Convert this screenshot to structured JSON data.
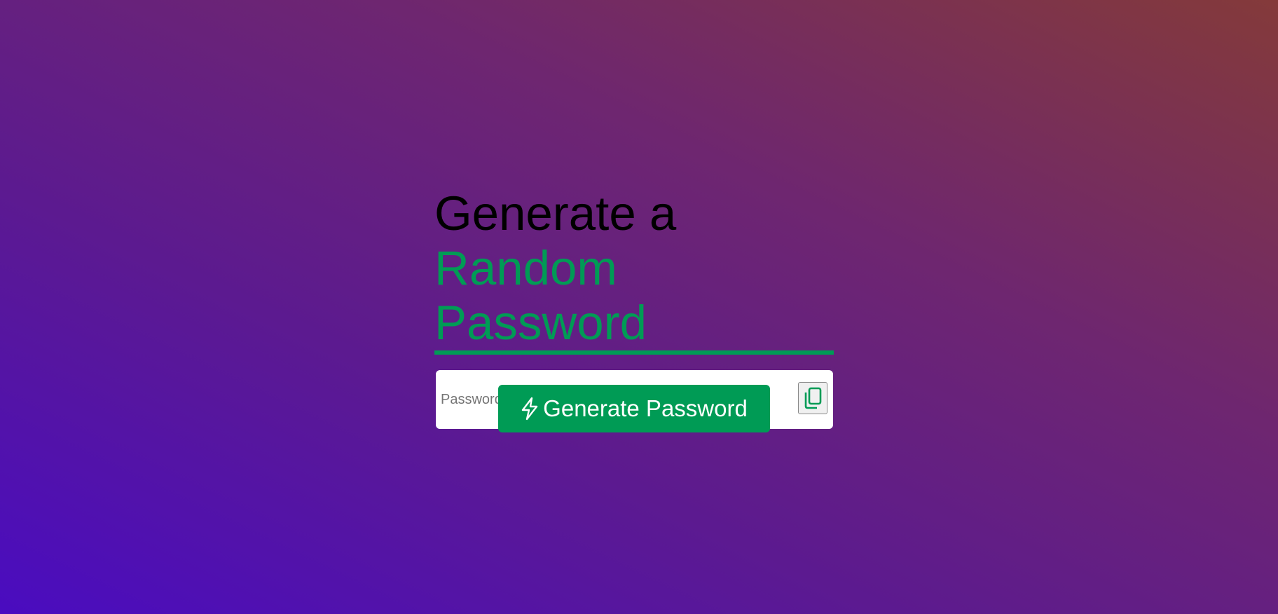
{
  "header": {
    "title_line1": "Generate a",
    "title_line2": "Random Password"
  },
  "password_field": {
    "value": "",
    "placeholder": "Password"
  },
  "copy_button": {
    "icon": "copy-icon"
  },
  "generate_button": {
    "icon": "lightning-icon",
    "label": "Generate Password"
  },
  "colors": {
    "accent": "#009b55",
    "background_start": "#4a0cc0",
    "background_end": "#843a3a"
  }
}
